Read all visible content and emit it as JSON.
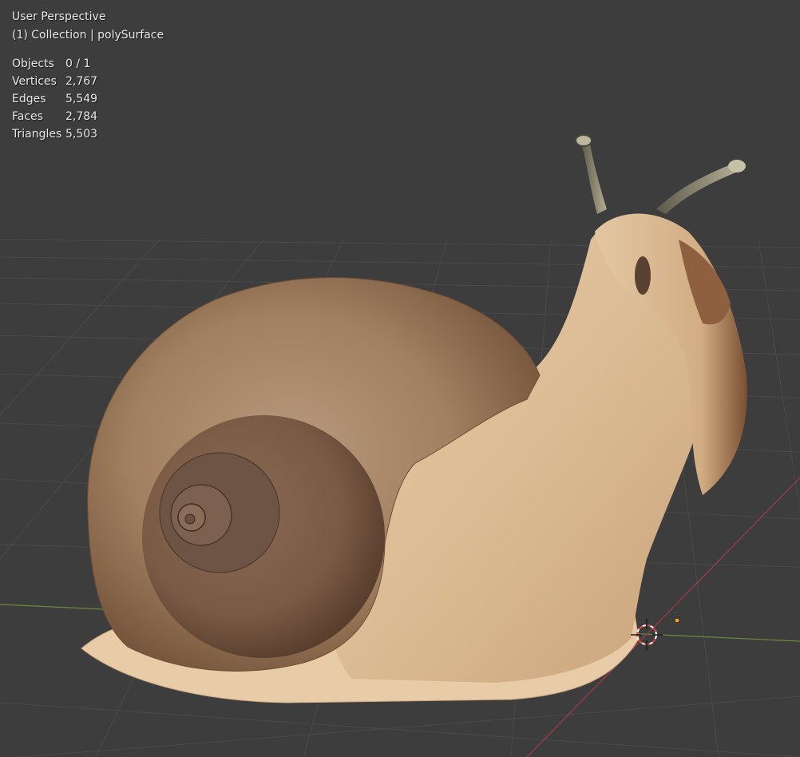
{
  "viewport": {
    "view_name": "User Perspective",
    "collection_info": "(1) Collection | polySurface",
    "stats": [
      {
        "label": "Objects",
        "value": "0 / 1"
      },
      {
        "label": "Vertices",
        "value": "2,767"
      },
      {
        "label": "Edges",
        "value": "5,549"
      },
      {
        "label": "Faces",
        "value": "2,784"
      },
      {
        "label": "Triangles",
        "value": "5,503"
      }
    ]
  },
  "colors": {
    "background": "#3d3d3d",
    "grid_line": "#4a4a4a",
    "x_axis": "#a33a4a",
    "y_axis": "#6a8a3a",
    "cursor_red": "#e04040",
    "origin_dot": "#f0a030"
  },
  "icons": [
    "3d-cursor-icon",
    "origin-point-icon"
  ]
}
